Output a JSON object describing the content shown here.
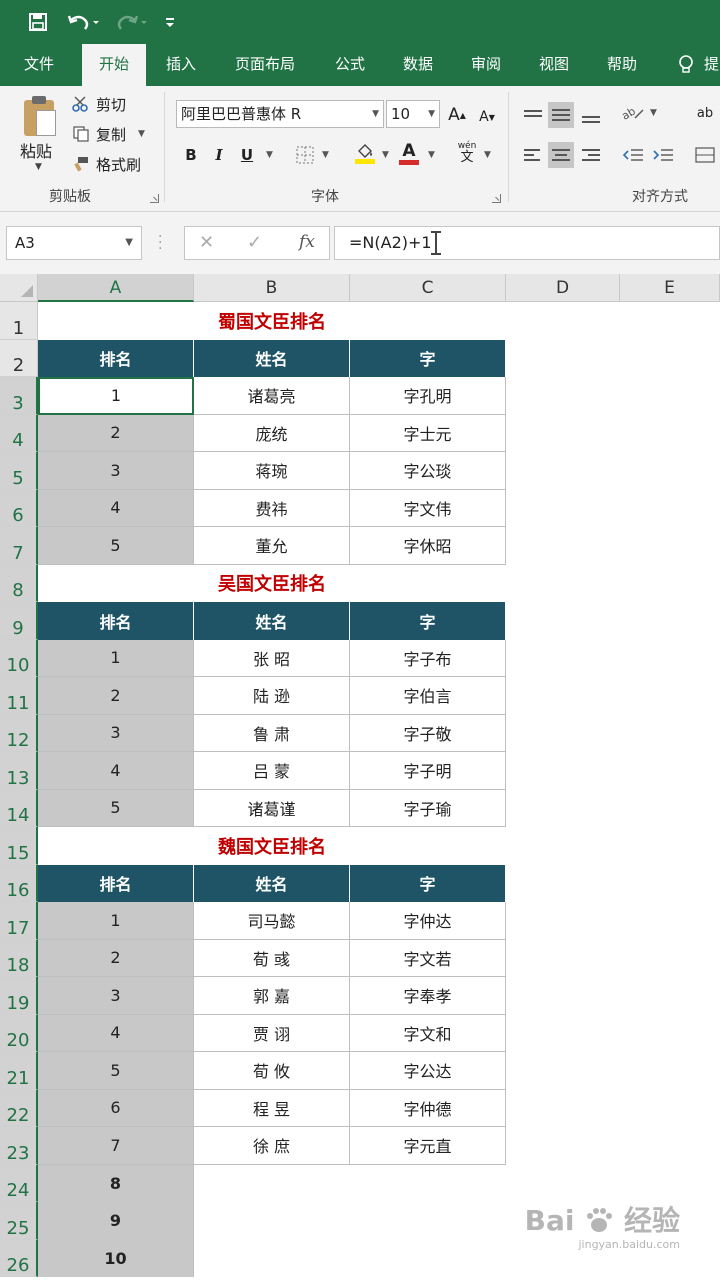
{
  "quick_access": {
    "save_icon": "save-icon",
    "undo_icon": "undo-icon",
    "redo_icon": "redo-icon",
    "customize_icon": "customize-quick-access-icon"
  },
  "ribbon_tabs": [
    "文件",
    "开始",
    "插入",
    "页面布局",
    "公式",
    "数据",
    "审阅",
    "视图",
    "帮助",
    "提"
  ],
  "active_tab": "开始",
  "clipboard_group": {
    "paste_label": "粘贴",
    "cut_label": "剪切",
    "copy_label": "复制",
    "format_painter_label": "格式刷",
    "group_label": "剪贴板"
  },
  "font_group": {
    "font_name": "阿里巴巴普惠体 R",
    "font_size": "10",
    "bold": "B",
    "italic": "I",
    "underline": "U",
    "phonetic_top": "wén",
    "phonetic_bottom": "文",
    "group_label": "字体",
    "font_color": "#d62b2b",
    "fill_color": "#ffe600"
  },
  "alignment_group": {
    "group_label": "对齐方式"
  },
  "formula_bar": {
    "name_box": "A3",
    "cancel": "✕",
    "enter": "✓",
    "fx": "fx",
    "formula": "=N(A2)+1"
  },
  "sheet": {
    "columns": [
      "A",
      "B",
      "C",
      "D",
      "E"
    ],
    "rows": [
      "1",
      "2",
      "3",
      "4",
      "5",
      "6",
      "7",
      "8",
      "9",
      "10",
      "11",
      "12",
      "13",
      "14",
      "15",
      "16",
      "17",
      "18",
      "19",
      "20",
      "21",
      "22",
      "23",
      "24",
      "25",
      "26"
    ],
    "header_labels": {
      "rank": "排名",
      "name": "姓名",
      "courtesy": "字"
    },
    "sections": [
      {
        "title": "蜀国文臣排名",
        "records": [
          {
            "rank": "1",
            "name": "诸葛亮",
            "courtesy": "字孔明"
          },
          {
            "rank": "2",
            "name": "庞统",
            "courtesy": "字士元"
          },
          {
            "rank": "3",
            "name": "蒋琬",
            "courtesy": "字公琰"
          },
          {
            "rank": "4",
            "name": "费祎",
            "courtesy": "字文伟"
          },
          {
            "rank": "5",
            "name": "董允",
            "courtesy": "字休昭"
          }
        ]
      },
      {
        "title": "吴国文臣排名",
        "records": [
          {
            "rank": "1",
            "name": "张 昭",
            "courtesy": "字子布"
          },
          {
            "rank": "2",
            "name": "陆 逊",
            "courtesy": "字伯言"
          },
          {
            "rank": "3",
            "name": "鲁 肃",
            "courtesy": "字子敬"
          },
          {
            "rank": "4",
            "name": "吕 蒙",
            "courtesy": "字子明"
          },
          {
            "rank": "5",
            "name": "诸葛谨",
            "courtesy": "字子瑜"
          }
        ]
      },
      {
        "title": "魏国文臣排名",
        "records": [
          {
            "rank": "1",
            "name": "司马懿",
            "courtesy": "字仲达"
          },
          {
            "rank": "2",
            "name": "荀 彧",
            "courtesy": "字文若"
          },
          {
            "rank": "3",
            "name": "郭 嘉",
            "courtesy": "字奉孝"
          },
          {
            "rank": "4",
            "name": "贾 诩",
            "courtesy": "字文和"
          },
          {
            "rank": "5",
            "name": "荀 攸",
            "courtesy": "字公达"
          },
          {
            "rank": "6",
            "name": "程 昱",
            "courtesy": "字仲德"
          },
          {
            "rank": "7",
            "name": "徐 庶",
            "courtesy": "字元直"
          }
        ],
        "extra_ranks": [
          "8",
          "9",
          "10"
        ]
      }
    ]
  },
  "watermark": {
    "brand": "Bai",
    "brand_cn": "经验",
    "url": "jingyan.baidu.com"
  },
  "colors": {
    "excel_green": "#217346",
    "table_header": "#1f5467",
    "title_red": "#c00000",
    "selection_gray": "#c8c8c8"
  }
}
